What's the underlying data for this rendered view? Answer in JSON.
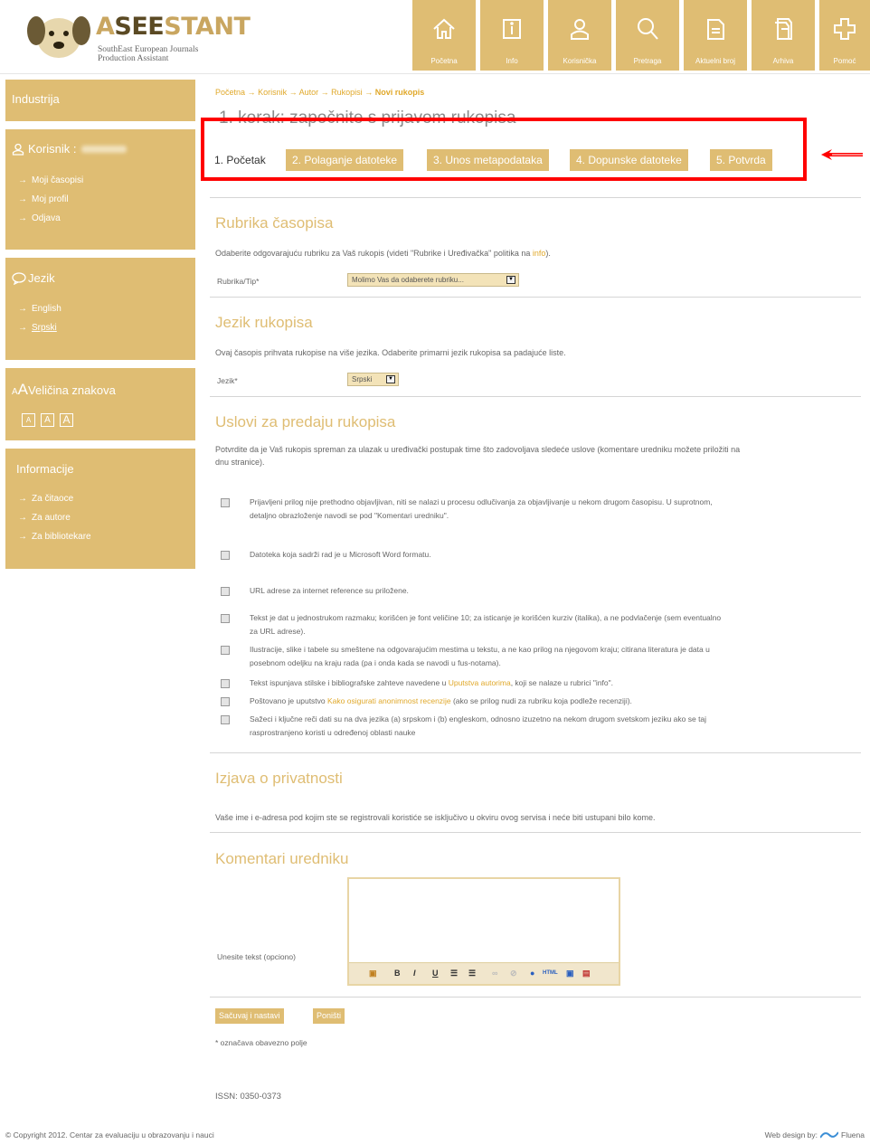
{
  "header": {
    "logo_title_a": "A",
    "logo_title_b": "SEE",
    "logo_title_c": "STANT",
    "logo_sub_1": "SouthEast European Journals",
    "logo_sub_2": "Production Assistant",
    "nav": [
      {
        "label": "Početna",
        "icon": "home-icon"
      },
      {
        "label": "Info",
        "icon": "info-icon"
      },
      {
        "label": "Korisnička",
        "icon": "user-icon"
      },
      {
        "label": "Pretraga",
        "icon": "search-icon"
      },
      {
        "label": "Aktuelni broj",
        "icon": "document-icon"
      },
      {
        "label": "Arhiva",
        "icon": "archive-icon"
      },
      {
        "label": "Pomoć",
        "icon": "help-icon"
      }
    ]
  },
  "sidebar": {
    "industry": "Industrija",
    "user_header": "Korisnik :",
    "user_links": [
      "Moji časopisi",
      "Moj profil",
      "Odjava"
    ],
    "lang_header": "Jezik",
    "lang_links": [
      "English",
      "Srpski"
    ],
    "font_header_a": "A",
    "font_header_b": "Veličina znakova",
    "font_sizes": [
      "A",
      "A",
      "A"
    ],
    "info_header": "Informacije",
    "info_links": [
      "Za čitaoce",
      "Za autore",
      "Za bibliotekare"
    ]
  },
  "main": {
    "breadcrumb": {
      "items": [
        "Početna",
        "Korisnik",
        "Autor",
        "Rukopisi"
      ],
      "current": "Novi rukopis",
      "sep": "→"
    },
    "title": "1. korak: započnite s prijavom rukopisa",
    "steps": [
      "1. Početak",
      "2. Polaganje datoteke",
      "3. Unos metapodataka",
      "4. Dopunske datoteke",
      "5. Potvrda"
    ],
    "section_rubrika": {
      "heading": "Rubrika časopisa",
      "text_before": "Odaberite odgovarajuću rubriku za Vaš rukopis (videti \"Rubrike i Uređivačka\" politika na ",
      "link": "info",
      "text_after": ").",
      "label": "Rubrika/Tip*",
      "select_value": "Molimo Vas da odaberete rubriku..."
    },
    "section_jezik": {
      "heading": "Jezik rukopisa",
      "text": "Ovaj časopis prihvata rukopise na više jezika. Odaberite primarni jezik rukopisa sa padajuće liste.",
      "label": "Jezik*",
      "select_value": "Srpski"
    },
    "section_uslovi": {
      "heading": "Uslovi za predaju rukopisa",
      "intro_1": "Potvrdite da je Vaš rukopis spreman za ulazak u uređivački postupak time što zadovoljava sledeće uslove (komentare uredniku možete priložiti na",
      "intro_2": "dnu stranice).",
      "items": [
        {
          "l1": "Prijavljeni prilog nije prethodno objavljivan, niti se nalazi u procesu odlučivanja za objavljivanje u nekom drugom časopisu. U suprotnom,",
          "l2": "detaljno obrazloženje  navodi se pod \"Komentari uredniku\"."
        },
        {
          "l1": "Datoteka koja sadrži rad je u Microsoft Word formatu.",
          "l2": ""
        },
        {
          "l1": "URL adrese za internet reference su priložene.",
          "l2": ""
        },
        {
          "l1": "Tekst je dat u jednostrukom razmaku; korišćen je font veličine 10; za isticanje je korišćen kurziv (italika), a ne podvlačenje (sem eventualno",
          "l2": "za URL adrese)."
        },
        {
          "l1": "Ilustracije, slike i tabele su smeštene na odgovarajućim mestima u tekstu, a ne kao prilog na njegovom kraju; citirana literatura je data u",
          "l2": "posebnom odeljku na kraju rada (pa i onda kada se navodi u fus-notama)."
        },
        {
          "l1_a": "Tekst ispunjava stilske i bibliografske zahteve navedene u ",
          "link": "Uputstva autorima",
          "l1_b": ", koji se nalaze u rubrici \"info\"."
        },
        {
          "l1_a": "Poštovano je uputstvo ",
          "link": "Kako osigurati anonimnost recenzije",
          "l1_b": " (ako se prilog nudi za rubriku koja podleže recenziji)."
        },
        {
          "l1": "Sažeci i ključne reči dati su na dva jezika (a)  srpskom i (b) engleskom, odnosno izuzetno na nekom drugom svetskom jeziku ako se taj",
          "l2": "rasprostranjeno koristi u određenoj oblasti nauke"
        }
      ]
    },
    "section_privatnost": {
      "heading": "Izjava o privatnosti",
      "text": "Vaše ime i e-adresa pod kojim ste se registrovali koristiće se isključivo u okviru ovog servisa i neće biti ustupani bilo kome."
    },
    "section_komentari": {
      "heading": "Komentari uredniku",
      "label": "Unesite tekst (opciono)",
      "value": ""
    },
    "buttons": {
      "save": "Sačuvaj i nastavi",
      "cancel": "Poništi"
    },
    "required_note": "* označava obavezno polje",
    "issn": "ISSN: 0350-0373"
  },
  "footer": {
    "copyright": "© Copyright 2012. Centar za evaluaciju u obrazovanju i nauci",
    "design": "Web design by:",
    "design_brand": "Fluena"
  },
  "colors": {
    "accent": "#dfbd73",
    "link": "#e0a82a",
    "highlight": "#ff0000"
  }
}
